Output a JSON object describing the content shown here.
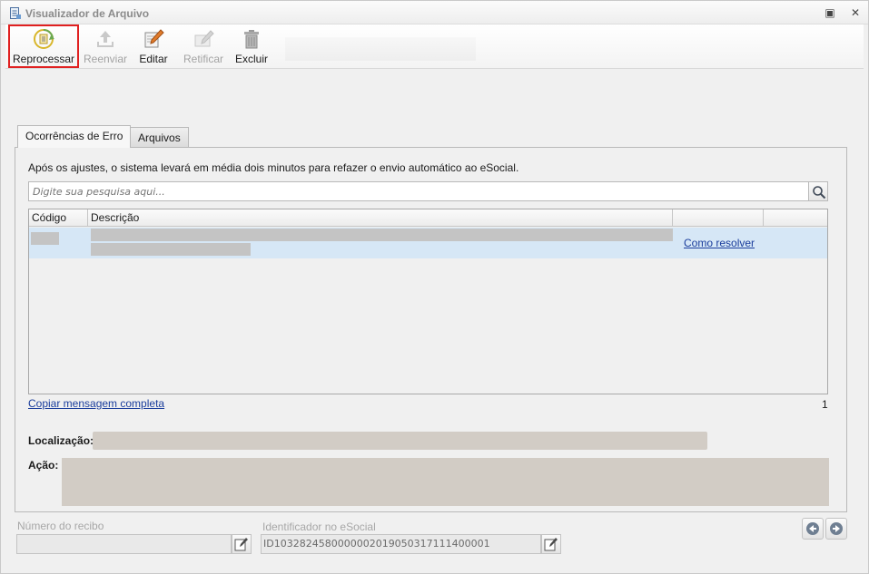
{
  "window": {
    "title": "Visualizador de Arquivo",
    "restore_glyph": "▣",
    "close_glyph": "✕"
  },
  "toolbar": {
    "reprocessar": "Reprocessar",
    "reenviar": "Reenviar",
    "editar": "Editar",
    "retificar": "Retificar",
    "excluir": "Excluir"
  },
  "tabs": {
    "ocorrencias": "Ocorrências de Erro",
    "arquivos": "Arquivos"
  },
  "panel": {
    "info": "Após os ajustes, o sistema levará em média dois minutos para refazer o envio automático ao eSocial.",
    "search_placeholder": "Digite sua pesquisa aqui...",
    "columns": [
      "Código",
      "Descrição",
      "",
      ""
    ],
    "row": {
      "link": "Como resolver"
    },
    "copy_link": "Copiar mensagem completa",
    "count": "1",
    "localizacao_label": "Localização:",
    "acao_label": "Ação:"
  },
  "footer": {
    "recibo_label": "Número do recibo",
    "recibo_value": "",
    "identificador_label": "Identificador no eSocial",
    "identificador_value": "ID1032824580000002019050317111400001"
  },
  "colors": {
    "highlight": "#e02020",
    "selected_row": "#d6e7f6",
    "link": "#1a3d9c"
  }
}
